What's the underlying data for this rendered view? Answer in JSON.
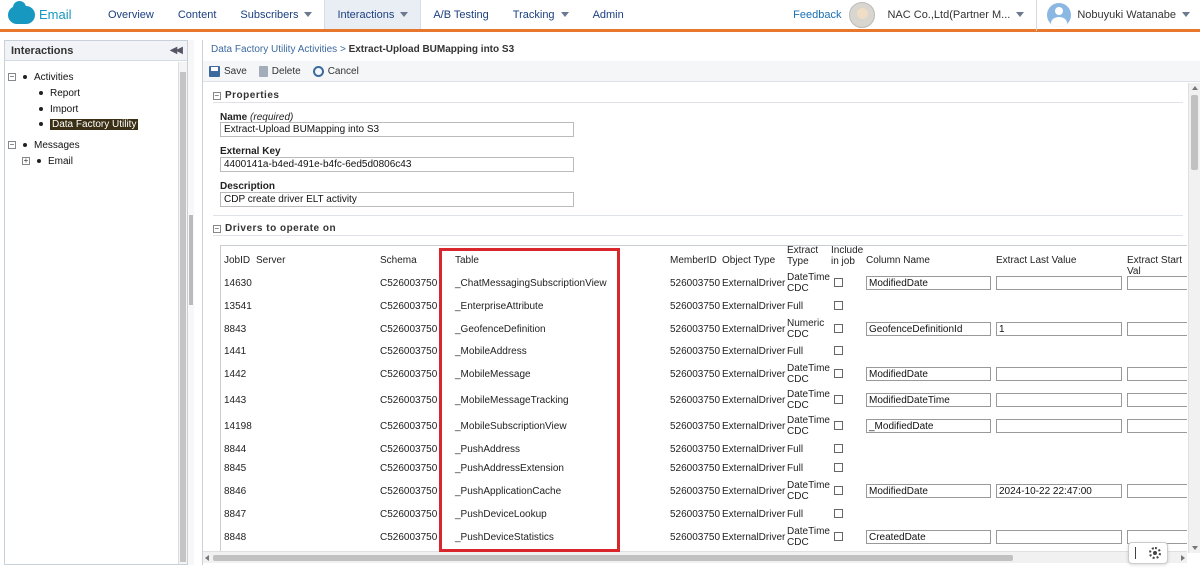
{
  "app": {
    "name": "Email"
  },
  "nav": {
    "tabs": [
      {
        "label": "Overview",
        "dropdown": false
      },
      {
        "label": "Content",
        "dropdown": false
      },
      {
        "label": "Subscribers",
        "dropdown": true
      },
      {
        "label": "Interactions",
        "dropdown": true,
        "active": true
      },
      {
        "label": "A/B Testing",
        "dropdown": false
      },
      {
        "label": "Tracking",
        "dropdown": true
      },
      {
        "label": "Admin",
        "dropdown": false
      }
    ],
    "feedback": "Feedback",
    "org": "NAC Co.,Ltd(Partner M...",
    "user": "Nobuyuki Watanabe"
  },
  "sidebar": {
    "title": "Interactions",
    "tree": {
      "activities": "Activities",
      "report": "Report",
      "import": "Import",
      "data_factory": "Data Factory Utility",
      "messages": "Messages",
      "email": "Email"
    }
  },
  "breadcrumb": {
    "parent": "Data Factory Utility Activities",
    "separator": ">",
    "current": "Extract-Upload BUMapping into S3"
  },
  "toolbar": {
    "save": "Save",
    "delete": "Delete",
    "cancel": "Cancel"
  },
  "properties": {
    "section_title": "Properties",
    "name_label": "Name",
    "name_hint": "(required)",
    "name_value": "Extract-Upload BUMapping into S3",
    "external_key_label": "External Key",
    "external_key_value": "4400141a-b4ed-491e-b4fc-6ed5d0806c43",
    "description_label": "Description",
    "description_value": "CDP create driver ELT activity"
  },
  "drivers": {
    "section_title": "Drivers to operate on",
    "headers": {
      "jobid": "JobID",
      "server": "Server",
      "schema": "Schema",
      "table": "Table",
      "memberid": "MemberID",
      "object_type": "Object Type",
      "extract_type": "Extract Type",
      "include": "Include in job",
      "column_name": "Column Name",
      "extract_last": "Extract Last Value",
      "extract_start": "Extract Start Val"
    },
    "rows": [
      {
        "jobid": "14630",
        "schema": "C526003750",
        "table": "_ChatMessagingSubscriptionView",
        "memberid": "526003750",
        "object_type": "ExternalDriver",
        "extract_type": "DateTime CDC",
        "column": "ModifiedDate",
        "last": "",
        "has_inputs": true
      },
      {
        "jobid": "13541",
        "schema": "C526003750",
        "table": "_EnterpriseAttribute",
        "memberid": "526003750",
        "object_type": "ExternalDriver",
        "extract_type": "Full",
        "has_inputs": false
      },
      {
        "jobid": "8843",
        "schema": "C526003750",
        "table": "_GeofenceDefinition",
        "memberid": "526003750",
        "object_type": "ExternalDriver",
        "extract_type": "Numeric CDC",
        "column": "GeofenceDefinitionId",
        "last": "1",
        "has_inputs": true
      },
      {
        "jobid": "1441",
        "schema": "C526003750",
        "table": "_MobileAddress",
        "memberid": "526003750",
        "object_type": "ExternalDriver",
        "extract_type": "Full",
        "has_inputs": false
      },
      {
        "jobid": "1442",
        "schema": "C526003750",
        "table": "_MobileMessage",
        "memberid": "526003750",
        "object_type": "ExternalDriver",
        "extract_type": "DateTime CDC",
        "column": "ModifiedDate",
        "last": "",
        "has_inputs": true
      },
      {
        "jobid": "1443",
        "schema": "C526003750",
        "table": "_MobileMessageTracking",
        "memberid": "526003750",
        "object_type": "ExternalDriver",
        "extract_type": "DateTime CDC",
        "column": "ModifiedDateTime",
        "last": "",
        "has_inputs": true
      },
      {
        "jobid": "14198",
        "schema": "C526003750",
        "table": "_MobileSubscriptionView",
        "memberid": "526003750",
        "object_type": "ExternalDriver",
        "extract_type": "DateTime CDC",
        "column": "_ModifiedDate",
        "last": "",
        "has_inputs": true
      },
      {
        "jobid": "8844",
        "schema": "C526003750",
        "table": "_PushAddress",
        "memberid": "526003750",
        "object_type": "ExternalDriver",
        "extract_type": "Full",
        "has_inputs": false
      },
      {
        "jobid": "8845",
        "schema": "C526003750",
        "table": "_PushAddressExtension",
        "memberid": "526003750",
        "object_type": "ExternalDriver",
        "extract_type": "Full",
        "has_inputs": false
      },
      {
        "jobid": "8846",
        "schema": "C526003750",
        "table": "_PushApplicationCache",
        "memberid": "526003750",
        "object_type": "ExternalDriver",
        "extract_type": "DateTime CDC",
        "column": "ModifiedDate",
        "last": "2024-10-22 22:47:00",
        "has_inputs": true
      },
      {
        "jobid": "8847",
        "schema": "C526003750",
        "table": "_PushDeviceLookup",
        "memberid": "526003750",
        "object_type": "ExternalDriver",
        "extract_type": "Full",
        "has_inputs": false
      },
      {
        "jobid": "8848",
        "schema": "C526003750",
        "table": "_PushDeviceStatistics",
        "memberid": "526003750",
        "object_type": "ExternalDriver",
        "extract_type": "DateTime CDC",
        "column": "CreatedDate",
        "last": "",
        "has_inputs": true
      }
    ]
  },
  "colors": {
    "brand": "#1798c1",
    "nav_accent": "#e8772e",
    "highlight_box": "#d9262c",
    "link": "#3d6a9e"
  }
}
